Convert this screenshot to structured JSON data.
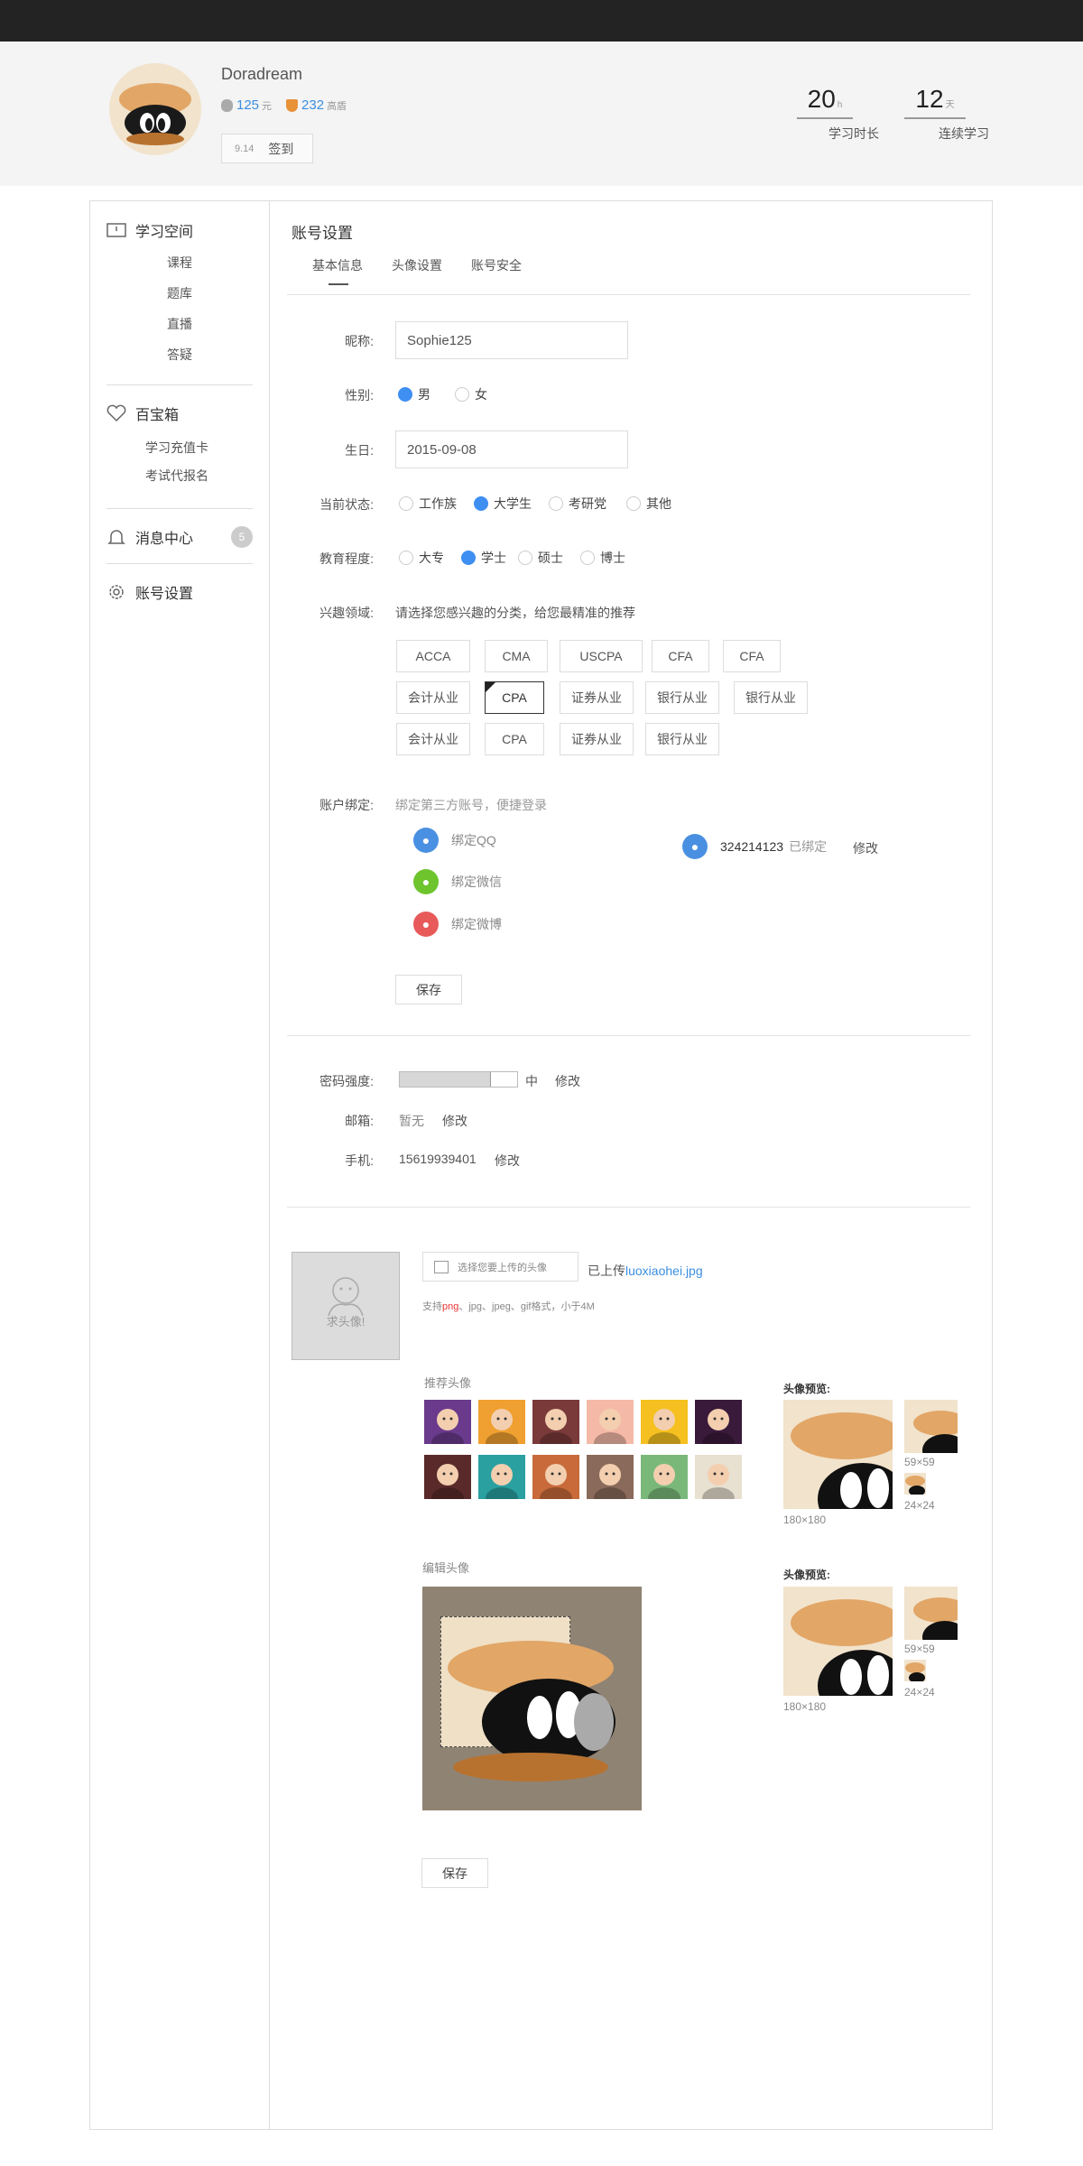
{
  "header": {
    "username": "Doradream",
    "coins_value": "125",
    "coins_unit": "元",
    "beans_value": "232",
    "beans_unit": "高盾",
    "sign_date": "9.14",
    "sign_label": "签到",
    "study_hours_value": "20",
    "study_hours_unit": "h",
    "study_hours_label": "学习时长",
    "streak_value": "12",
    "streak_unit": "天",
    "streak_label": "连续学习"
  },
  "sidebar": {
    "section1_title": "学习空间",
    "section1_items": [
      "课程",
      "题库",
      "直播",
      "答疑"
    ],
    "section2_title": "百宝箱",
    "section2_items": [
      "学习充值卡",
      "考试代报名"
    ],
    "section3_title": "消息中心",
    "section3_badge": "5",
    "section4_title": "账号设置"
  },
  "main": {
    "title": "账号设置",
    "tabs": [
      "基本信息",
      "头像设置",
      "账号安全"
    ],
    "nickname_label": "昵称:",
    "nickname_value": "Sophie125",
    "gender_label": "性别:",
    "gender_options": [
      "男",
      "女"
    ],
    "gender_selected": "男",
    "birthday_label": "生日:",
    "birthday_value": "2015-09-08",
    "status_label": "当前状态:",
    "status_options": [
      "工作族",
      "大学生",
      "考研党",
      "其他"
    ],
    "status_selected": "大学生",
    "edu_label": "教育程度:",
    "edu_options": [
      "大专",
      "学士",
      "硕士",
      "博士"
    ],
    "edu_selected": "学士",
    "interest_label": "兴趣领域:",
    "interest_hint": "请选择您感兴趣的分类，给您最精准的推荐",
    "interest_row1": [
      "ACCA",
      "CMA",
      "USCPA",
      "CFA",
      "CFA"
    ],
    "interest_row2": [
      "会计从业",
      "CPA",
      "证券从业",
      "银行从业",
      "银行从业"
    ],
    "interest_row3": [
      "会计从业",
      "CPA",
      "证券从业",
      "银行从业"
    ],
    "interest_selected": "CPA",
    "binding_label": "账户绑定:",
    "binding_hint": "绑定第三方账号，便捷登录",
    "bind_qq": "绑定QQ",
    "bind_wechat": "绑定微信",
    "bind_weibo": "绑定微博",
    "bound_qq_number": "324214123",
    "bound_status": "已绑定",
    "modify": "修改",
    "save": "保存",
    "password_label": "密码强度:",
    "password_strength_text": "中",
    "password_strength_fraction": 0.78,
    "email_label": "邮箱:",
    "email_value": "暂无",
    "phone_label": "手机:",
    "phone_value": "15619939401"
  },
  "avatar": {
    "placeholder_text": "求头像!",
    "upload_placeholder": "选择您要上传的头像",
    "uploaded_prefix": "已上传",
    "uploaded_file": "luoxiaohei.jpg",
    "format_hint_pre": "支持",
    "format_png": "png",
    "format_hint_post": "、jpg、jpeg、gif格式，小于4M",
    "recommended_title": "推荐头像",
    "preview_title": "头像预览:",
    "size_large": "180×180",
    "size_medium": "59×59",
    "size_small": "24×24",
    "edit_title": "编辑头像",
    "save": "保存",
    "thumb_colors": [
      "#6a3a8c",
      "#f0a030",
      "#7a3a3a",
      "#f5b9a8",
      "#f5c020",
      "#3a1a3a",
      "#5a2a2a",
      "#2aa0a0",
      "#c86a3a",
      "#8a6a5a",
      "#7ab87a",
      "#e8e0d0"
    ]
  }
}
